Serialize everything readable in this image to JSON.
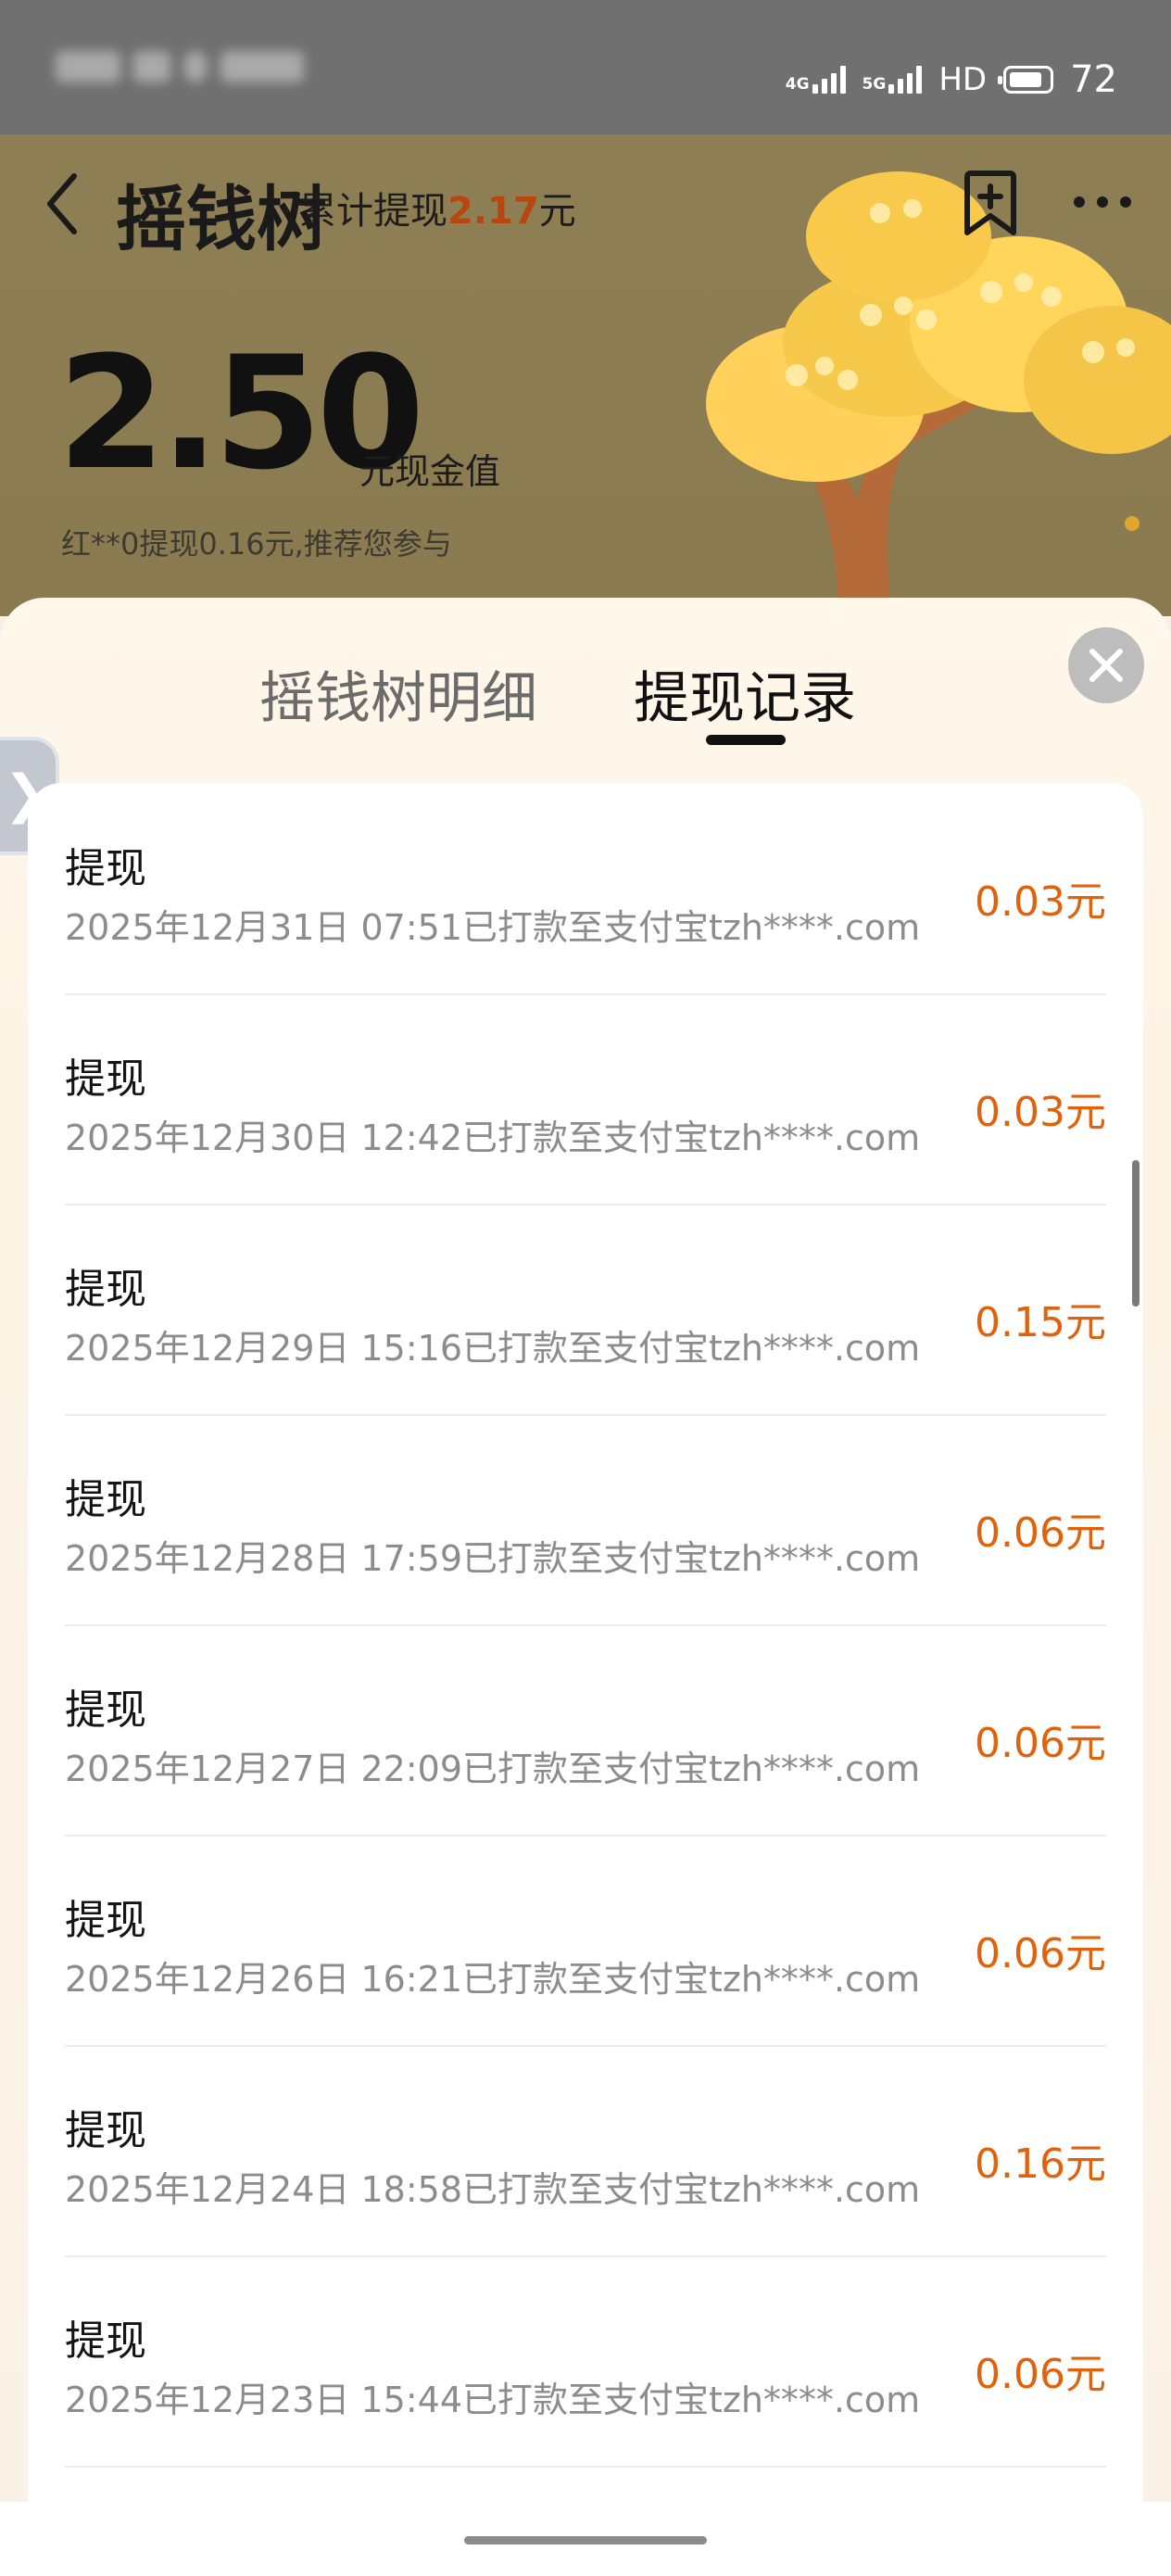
{
  "status_bar": {
    "net1": "4G",
    "net2": "5G",
    "hd": "HD",
    "battery": "72"
  },
  "header": {
    "title": "摇钱树",
    "total_prefix": "累计提现",
    "total_value": "2.17",
    "total_suffix": "元",
    "balance": "2.50",
    "balance_unit": "元现金值",
    "recommend": "红**0提现0.16元,推荐您参与"
  },
  "tabs": [
    {
      "label": "摇钱树明细",
      "active": false
    },
    {
      "label": "提现记录",
      "active": true
    }
  ],
  "records": [
    {
      "title": "提现",
      "detail": "2025年12月31日 07:51已打款至支付宝tzh****.com",
      "amount": "0.03元"
    },
    {
      "title": "提现",
      "detail": "2025年12月30日 12:42已打款至支付宝tzh****.com",
      "amount": "0.03元"
    },
    {
      "title": "提现",
      "detail": "2025年12月29日 15:16已打款至支付宝tzh****.com",
      "amount": "0.15元"
    },
    {
      "title": "提现",
      "detail": "2025年12月28日 17:59已打款至支付宝tzh****.com",
      "amount": "0.06元"
    },
    {
      "title": "提现",
      "detail": "2025年12月27日 22:09已打款至支付宝tzh****.com",
      "amount": "0.06元"
    },
    {
      "title": "提现",
      "detail": "2025年12月26日 16:21已打款至支付宝tzh****.com",
      "amount": "0.06元"
    },
    {
      "title": "提现",
      "detail": "2025年12月24日 18:58已打款至支付宝tzh****.com",
      "amount": "0.16元"
    },
    {
      "title": "提现",
      "detail": "2025年12月23日 15:44已打款至支付宝tzh****.com",
      "amount": "0.06元"
    }
  ],
  "colors": {
    "accent": "#e0620d",
    "header_bg": "#8f7f55"
  },
  "icons": [
    "back-icon",
    "bookmark-add-icon",
    "more-icon",
    "close-icon",
    "chevron-right-icon"
  ]
}
